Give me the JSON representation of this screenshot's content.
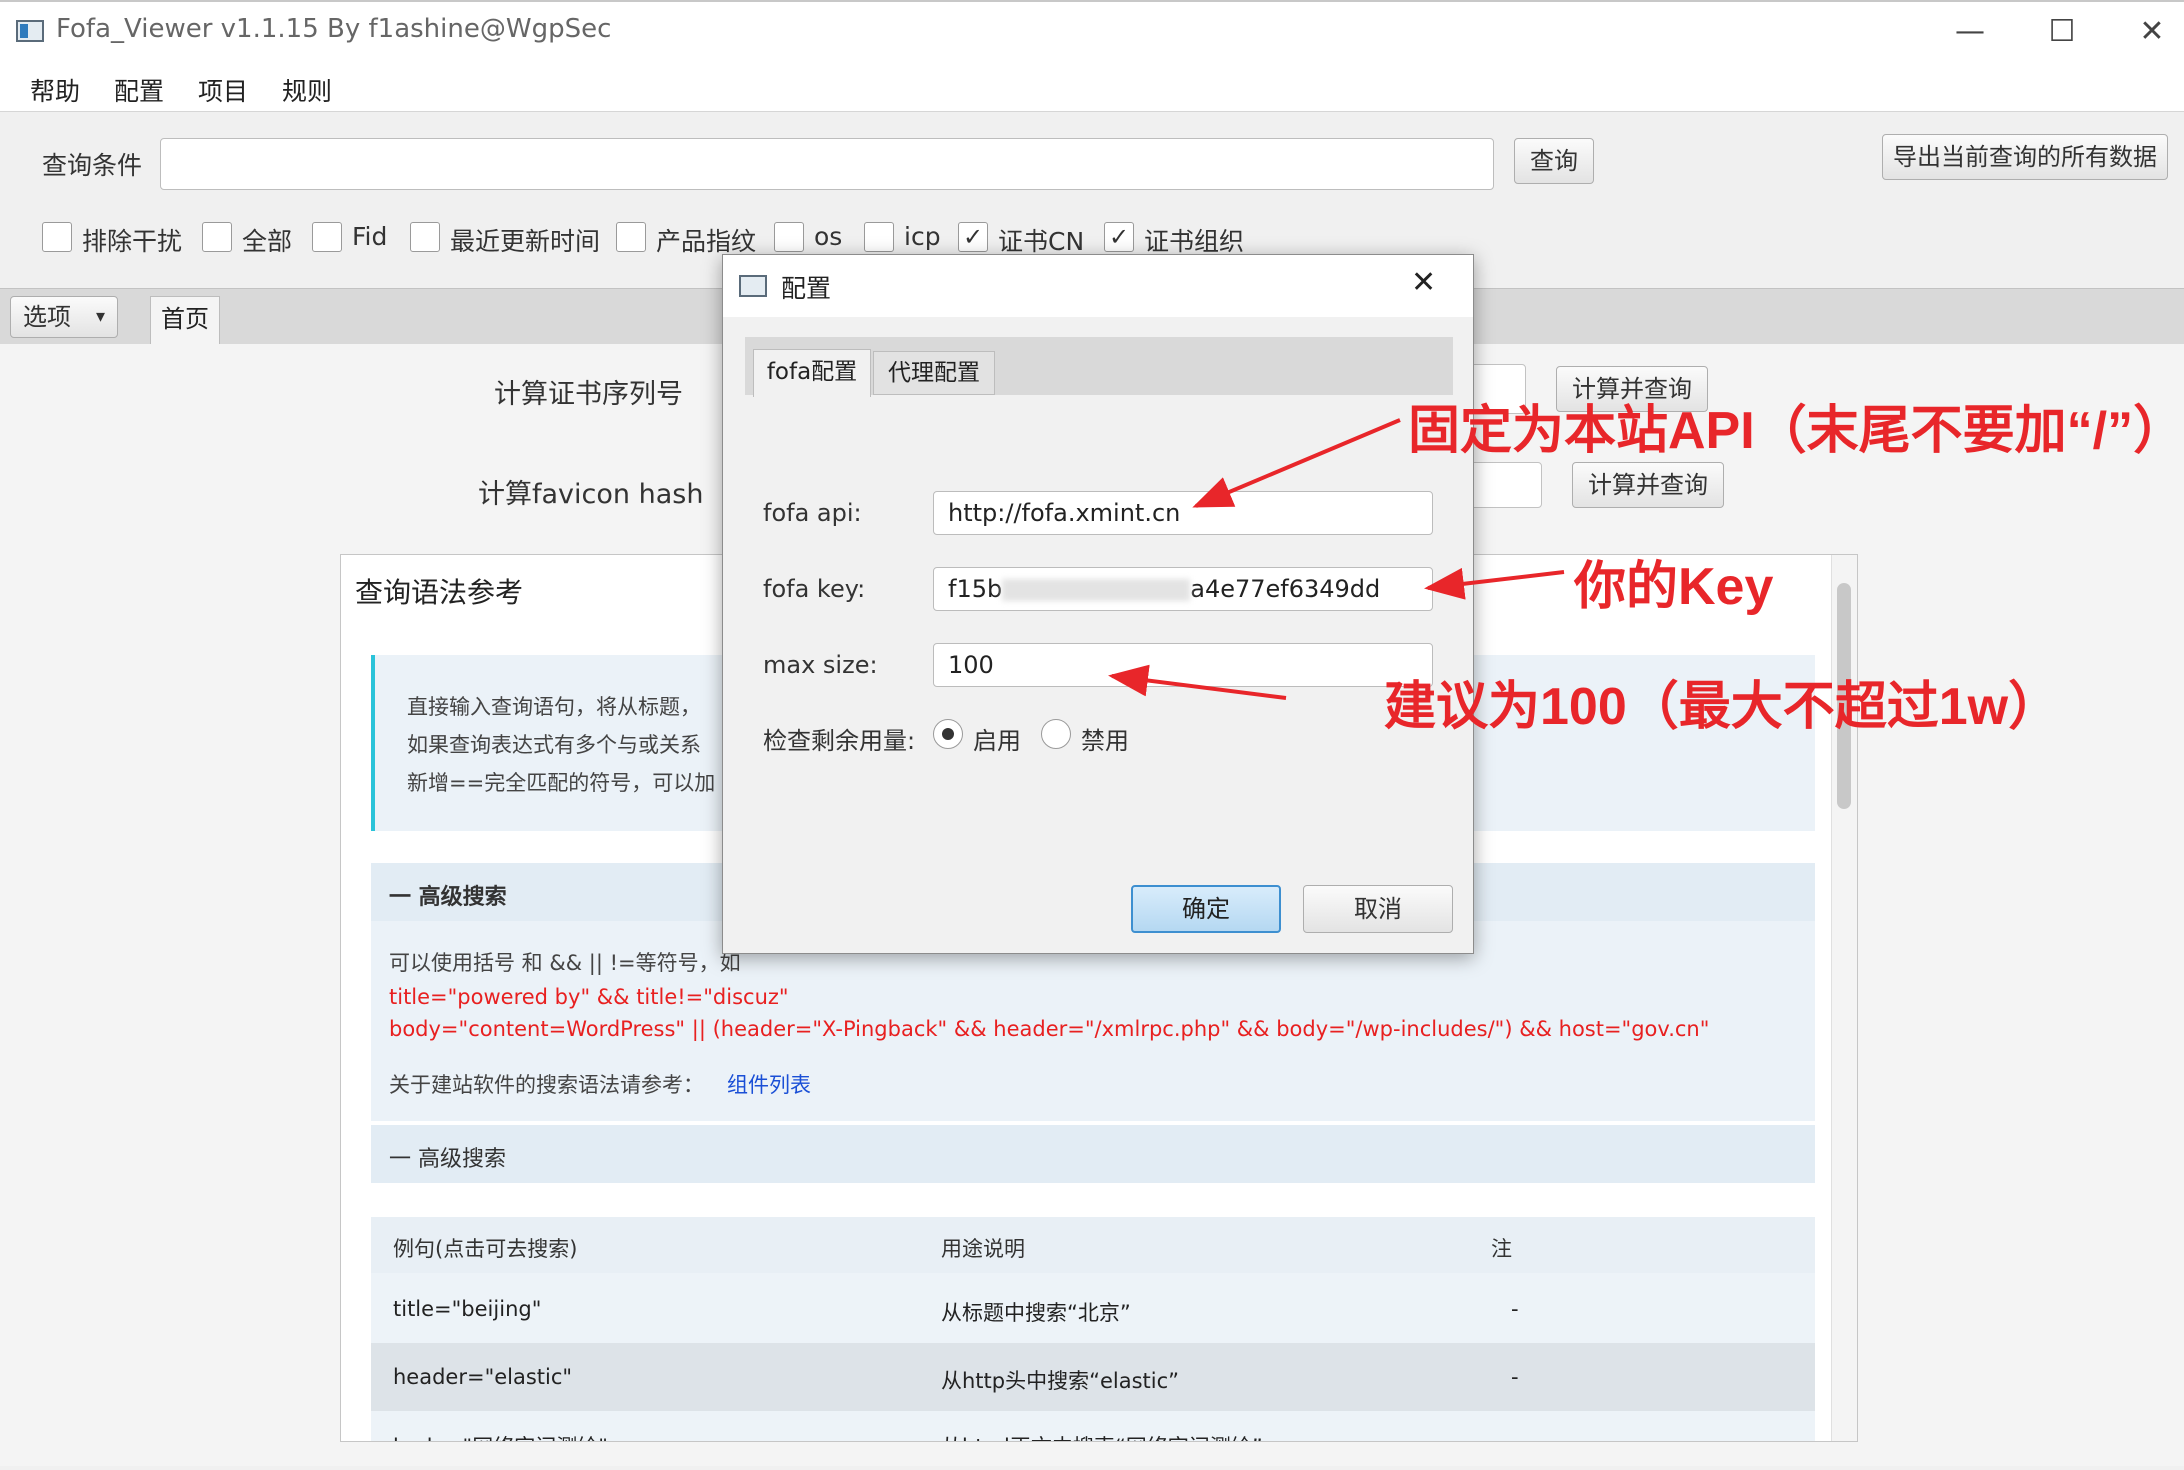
{
  "window": {
    "title": "Fofa_Viewer v1.1.15 By f1ashine@WgpSec",
    "minimize": "—",
    "maximize": "☐",
    "close": "✕"
  },
  "menu": [
    "帮助",
    "配置",
    "项目",
    "规则"
  ],
  "toolbar": {
    "query_label": "查询条件",
    "query_value": "",
    "query_button": "查询",
    "export_button": "导出当前查询的所有数据",
    "checkboxes": [
      {
        "label": "排除干扰",
        "checked": false
      },
      {
        "label": "全部",
        "checked": false
      },
      {
        "label": "Fid",
        "checked": false
      },
      {
        "label": "最近更新时间",
        "checked": false
      },
      {
        "label": "产品指纹",
        "checked": false
      },
      {
        "label": "os",
        "checked": false
      },
      {
        "label": "icp",
        "checked": false
      },
      {
        "label": "证书CN",
        "checked": true
      },
      {
        "label": "证书组织",
        "checked": true
      }
    ]
  },
  "tabs": {
    "options": "选项",
    "options_arrow": "▾",
    "home": "首页"
  },
  "home": {
    "cert_label": "计算证书序列号",
    "cert_button": "计算并查询",
    "favicon_label": "计算favicon hash",
    "favicon_button": "计算并查询"
  },
  "reference": {
    "title": "查询语法参考",
    "intro": [
      "直接输入查询语句，将从标题，",
      "如果查询表达式有多个与或关系",
      "新增==完全匹配的符号，可以加"
    ],
    "section1": "一  高级搜索",
    "section1_text": "可以使用括号 和 && || !=等符号，如",
    "example1": "title=\"powered by\" && title!=\"discuz\"",
    "example2": "body=\"content=WordPress\" || (header=\"X-Pingback\" && header=\"/xmlrpc.php\" && body=\"/wp-includes/\") && host=\"gov.cn\"",
    "ref_text": "关于建站软件的搜索语法请参考：",
    "ref_link": "组件列表",
    "section2": "一  高级搜索",
    "table_headers": [
      "例句(点击可去搜索)",
      "用途说明",
      "注"
    ],
    "rows": [
      [
        "title=\"beijing\"",
        "从标题中搜索“北京”",
        "-"
      ],
      [
        "header=\"elastic\"",
        "从http头中搜索“elastic”",
        "-"
      ],
      [
        "body=\"网络空间测绘\"",
        "从html正文中搜索“网络空间测绘”",
        ""
      ]
    ]
  },
  "dialog": {
    "title": "配置",
    "close": "✕",
    "tabs": [
      "fofa配置",
      "代理配置"
    ],
    "api_label": "fofa api:",
    "api_value": "http://fofa.xmint.cn",
    "key_label": "fofa key:",
    "key_prefix": "f15b",
    "key_suffix": "a4e77ef6349dd",
    "size_label": "max size:",
    "size_value": "100",
    "check_label": "检查剩余用量:",
    "radio_on": "启用",
    "radio_off": "禁用",
    "radio_selected": "启用",
    "ok": "确定",
    "cancel": "取消"
  },
  "annotations": {
    "api_note": "固定为本站API（末尾不要加“/”）",
    "key_note": "你的Key",
    "size_note": "建议为100（最大不超过1w）",
    "color": "#e8262a"
  }
}
